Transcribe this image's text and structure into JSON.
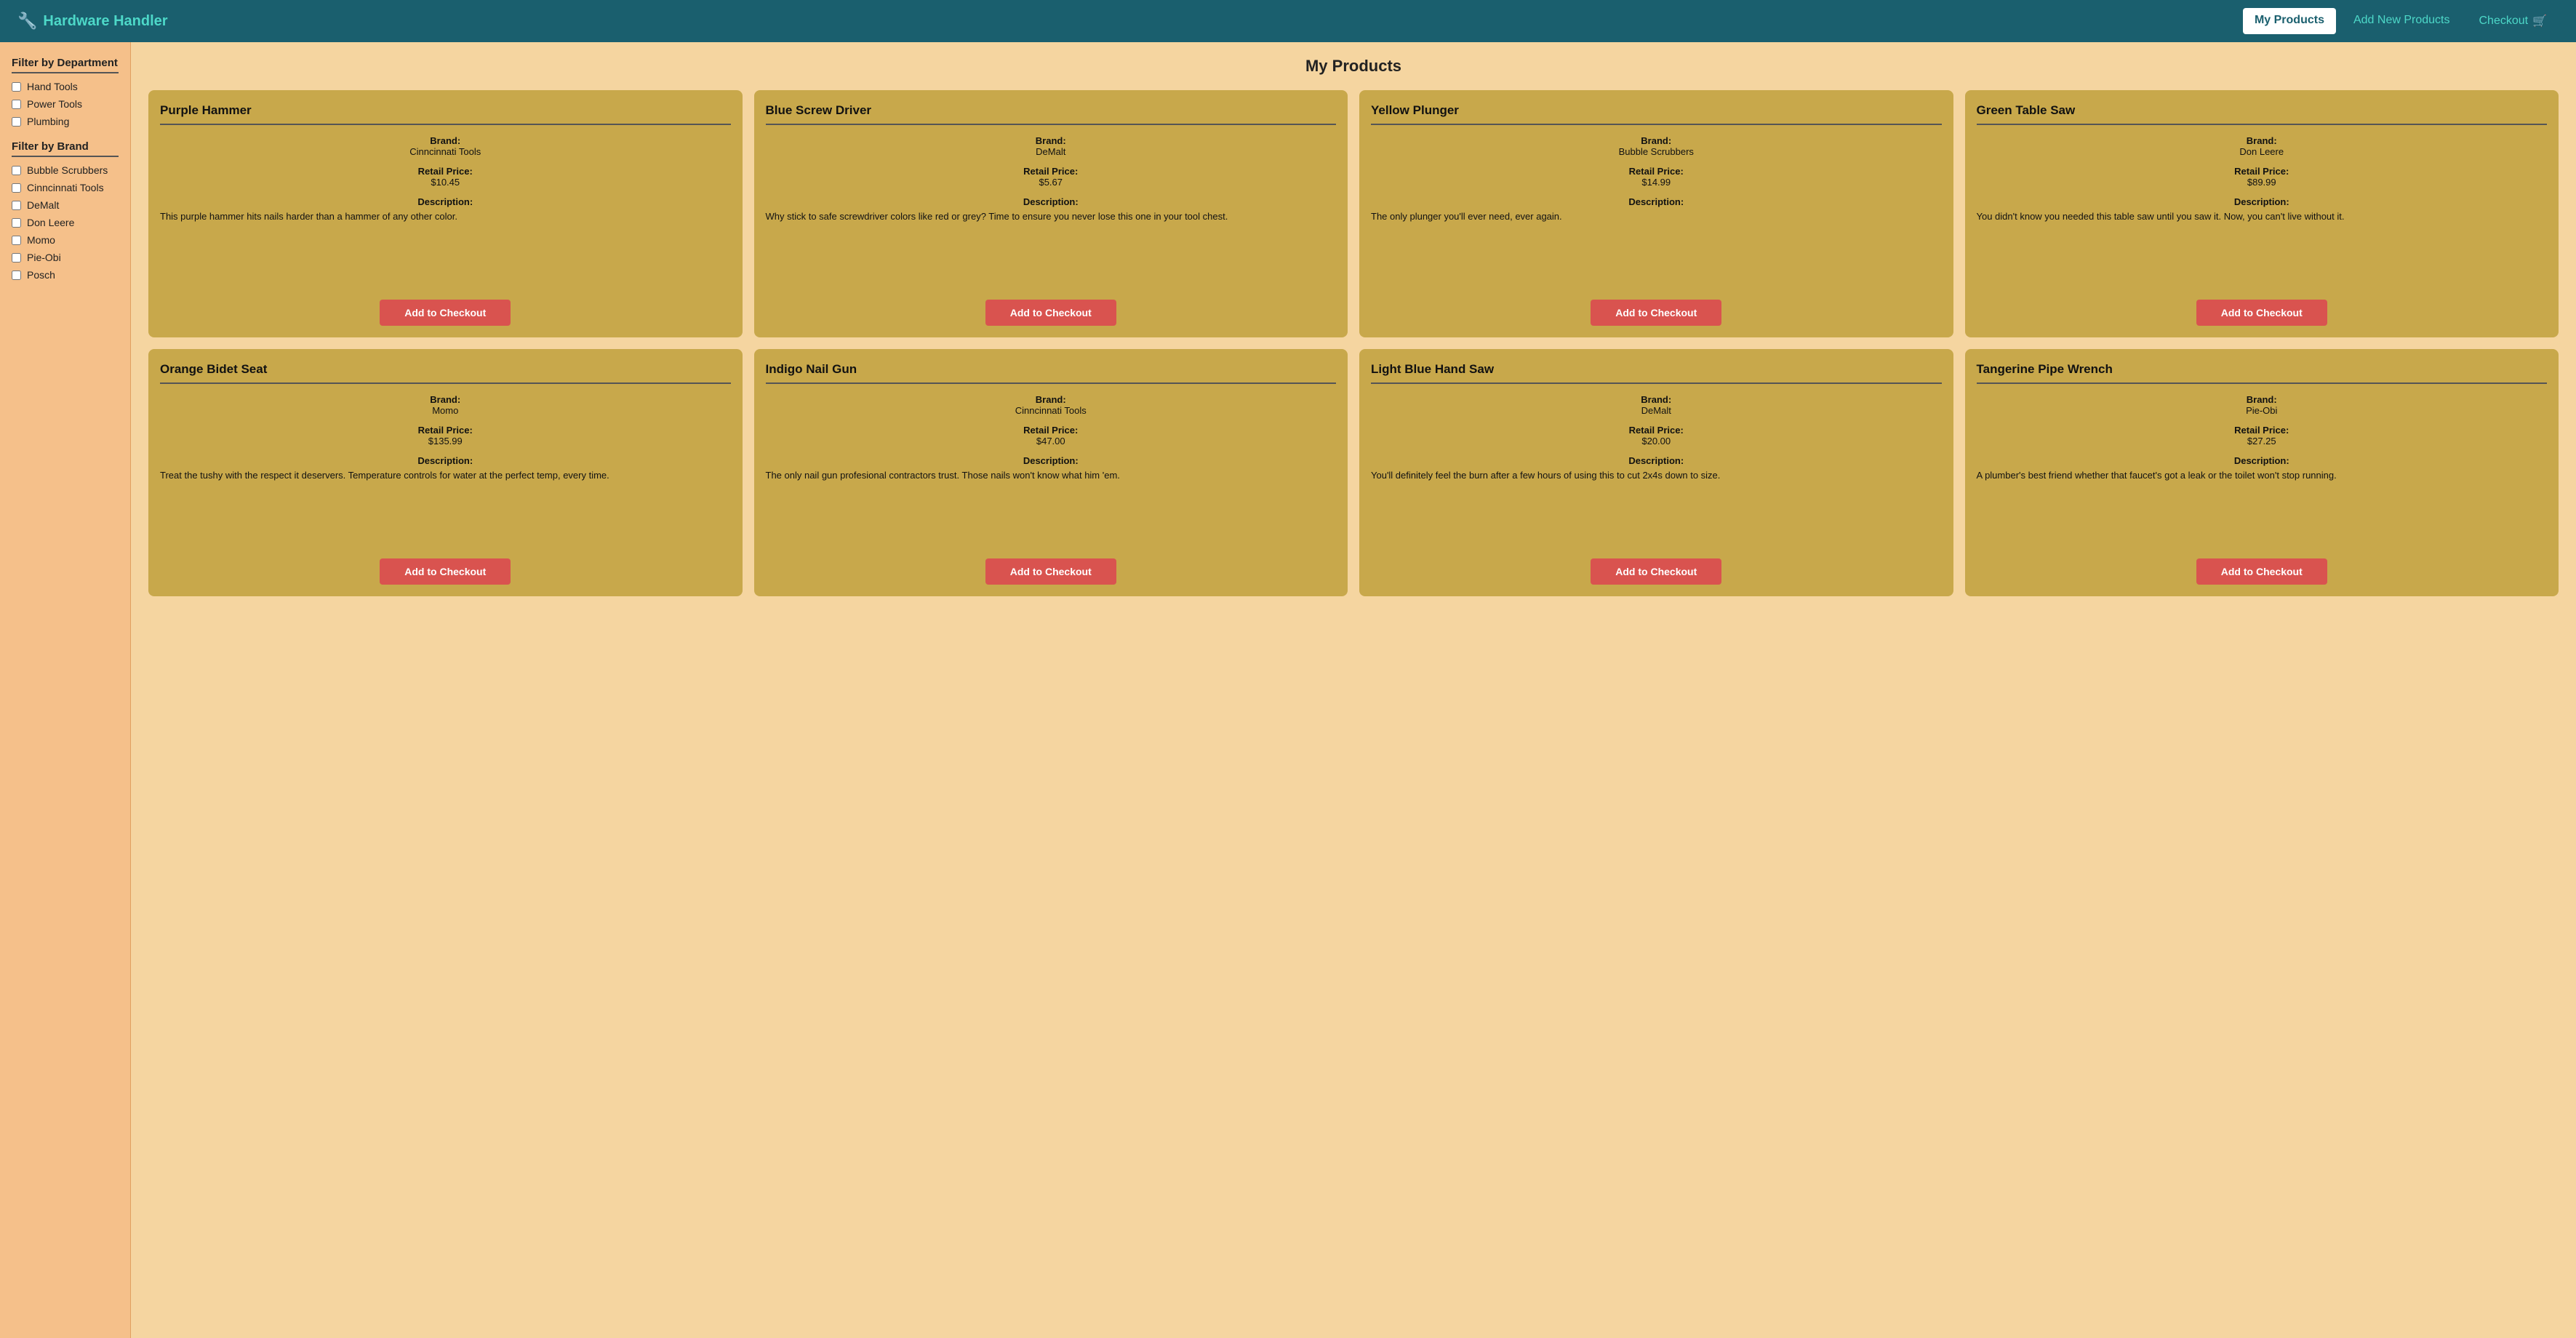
{
  "nav": {
    "brand": "Hardware Handler",
    "brand_icon": "🔧",
    "links": [
      {
        "id": "my-products",
        "label": "My Products",
        "active": true
      },
      {
        "id": "add-new-products",
        "label": "Add New Products",
        "active": false
      },
      {
        "id": "checkout",
        "label": "Checkout",
        "active": false,
        "icon": "🛒"
      }
    ]
  },
  "sidebar": {
    "dept_title": "Filter by Department",
    "departments": [
      {
        "id": "hand-tools",
        "label": "Hand Tools"
      },
      {
        "id": "power-tools",
        "label": "Power Tools"
      },
      {
        "id": "plumbing",
        "label": "Plumbing"
      }
    ],
    "brand_title": "Filter by Brand",
    "brands": [
      {
        "id": "bubble-scrubbers",
        "label": "Bubble Scrubbers"
      },
      {
        "id": "cinncinnati-tools",
        "label": "Cinncinnati Tools"
      },
      {
        "id": "demalt",
        "label": "DeMalt"
      },
      {
        "id": "don-leere",
        "label": "Don Leere"
      },
      {
        "id": "momo",
        "label": "Momo"
      },
      {
        "id": "pie-obi",
        "label": "Pie-Obi"
      },
      {
        "id": "posch",
        "label": "Posch"
      }
    ]
  },
  "page": {
    "title": "My Products"
  },
  "products": [
    {
      "id": "purple-hammer",
      "name": "Purple Hammer",
      "brand_label": "Brand:",
      "brand": "Cinncinnati Tools",
      "price_label": "Retail Price:",
      "price": "$10.45",
      "desc_label": "Description:",
      "description": "This purple hammer hits nails harder than a hammer of any other color.",
      "btn_label": "Add to Checkout"
    },
    {
      "id": "blue-screw-driver",
      "name": "Blue Screw Driver",
      "brand_label": "Brand:",
      "brand": "DeMalt",
      "price_label": "Retail Price:",
      "price": "$5.67",
      "desc_label": "Description:",
      "description": "Why stick to safe screwdriver colors like red or grey? Time to ensure you never lose this one in your tool chest.",
      "btn_label": "Add to Checkout"
    },
    {
      "id": "yellow-plunger",
      "name": "Yellow Plunger",
      "brand_label": "Brand:",
      "brand": "Bubble Scrubbers",
      "price_label": "Retail Price:",
      "price": "$14.99",
      "desc_label": "Description:",
      "description": "The only plunger you'll ever need, ever again.",
      "btn_label": "Add to Checkout"
    },
    {
      "id": "green-table-saw",
      "name": "Green Table Saw",
      "brand_label": "Brand:",
      "brand": "Don Leere",
      "price_label": "Retail Price:",
      "price": "$89.99",
      "desc_label": "Description:",
      "description": "You didn't know you needed this table saw until you saw it. Now, you can't live without it.",
      "btn_label": "Add to Checkout"
    },
    {
      "id": "orange-bidet-seat",
      "name": "Orange Bidet Seat",
      "brand_label": "Brand:",
      "brand": "Momo",
      "price_label": "Retail Price:",
      "price": "$135.99",
      "desc_label": "Description:",
      "description": "Treat the tushy with the respect it deservers. Temperature controls for water at the perfect temp, every time.",
      "btn_label": "Add to Checkout"
    },
    {
      "id": "indigo-nail-gun",
      "name": "Indigo Nail Gun",
      "brand_label": "Brand:",
      "brand": "Cinncinnati Tools",
      "price_label": "Retail Price:",
      "price": "$47.00",
      "desc_label": "Description:",
      "description": "The only nail gun profesional contractors trust. Those nails won't know what him 'em.",
      "btn_label": "Add to Checkout"
    },
    {
      "id": "light-blue-hand-saw",
      "name": "Light Blue Hand Saw",
      "brand_label": "Brand:",
      "brand": "DeMalt",
      "price_label": "Retail Price:",
      "price": "$20.00",
      "desc_label": "Description:",
      "description": "You'll definitely feel the burn after a few hours of using this to cut 2x4s down to size.",
      "btn_label": "Add to Checkout"
    },
    {
      "id": "tangerine-pipe-wrench",
      "name": "Tangerine Pipe Wrench",
      "brand_label": "Brand:",
      "brand": "Pie-Obi",
      "price_label": "Retail Price:",
      "price": "$27.25",
      "desc_label": "Description:",
      "description": "A plumber's best friend whether that faucet's got a leak or the toilet won't stop running.",
      "btn_label": "Add to Checkout"
    }
  ],
  "add_to_checkout_label": "Add to Checkout"
}
